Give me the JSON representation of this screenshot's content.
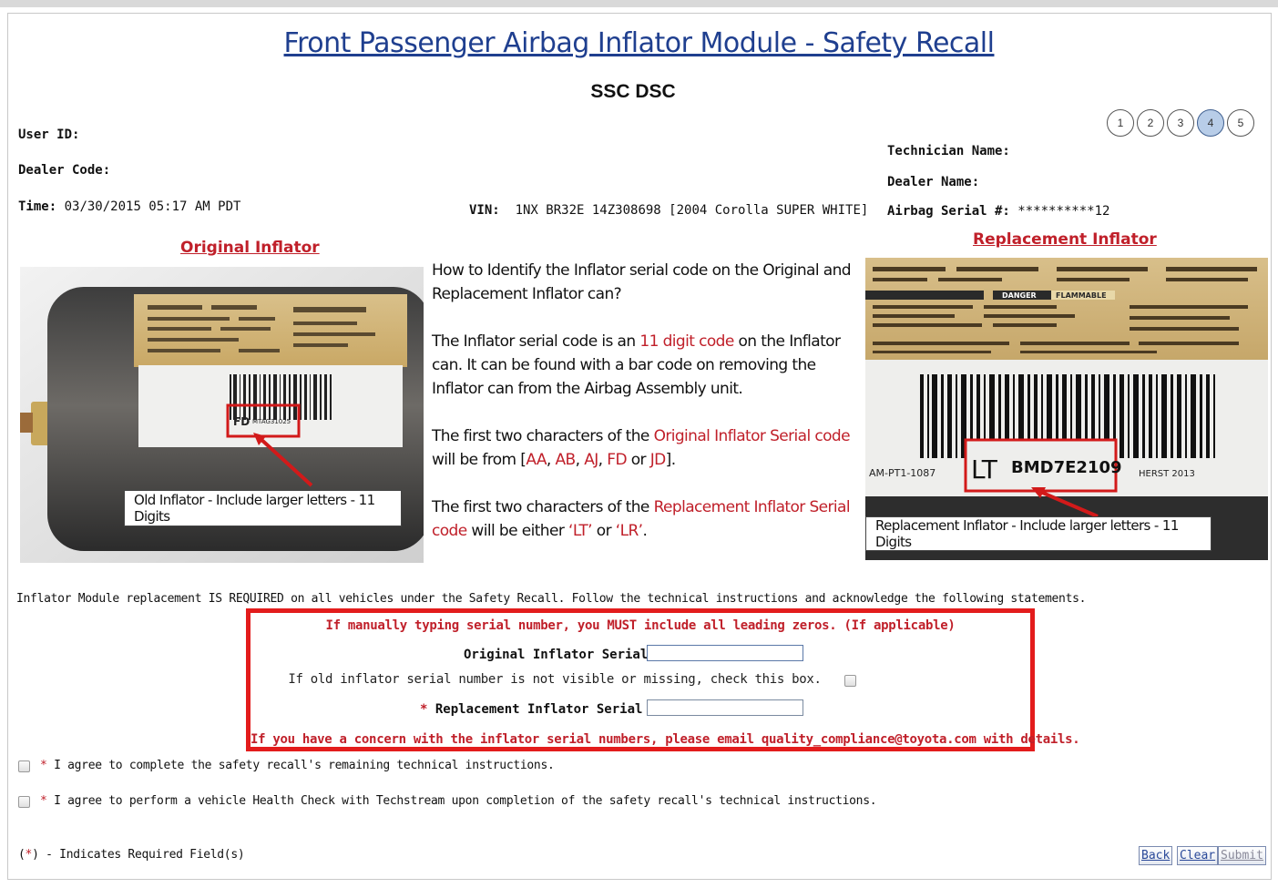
{
  "page": {
    "title": "Front Passenger Airbag Inflator Module - Safety Recall",
    "subtitle": "SSC DSC"
  },
  "steps": [
    {
      "label": "1",
      "active": false
    },
    {
      "label": "2",
      "active": false
    },
    {
      "label": "3",
      "active": false
    },
    {
      "label": "4",
      "active": true
    },
    {
      "label": "5",
      "active": false
    }
  ],
  "info": {
    "user_id_label": "User ID:",
    "dealer_code_label": "Dealer Code:",
    "time_label": "Time:",
    "time_value": "03/30/2015 05:17 AM PDT",
    "vin_label": "VIN:",
    "vin_value": "1NX BR32E 14Z308698 [2004 Corolla SUPER WHITE]",
    "technician_name_label": "Technician Name:",
    "dealer_name_label": "Dealer Name:",
    "airbag_serial_label": "Airbag Serial #:",
    "airbag_serial_value": "**********12"
  },
  "original": {
    "heading": "Original Inflator",
    "caption": "Old Inflator - Include larger letters - 11 Digits",
    "label_prefix": "FD",
    "label_code": "MTAG31025"
  },
  "replacement": {
    "heading": "Replacement Inflator",
    "caption": "Replacement Inflator - Include larger letters - 11 Digits",
    "label_prefix": "LT",
    "label_code": "BMD7E2109",
    "label_left": "AM-PT1-1087",
    "label_right": "HERST 2013",
    "danger_text": "DANGER",
    "flammable_text": "FLAMMABLE"
  },
  "instructions": {
    "question": "How to Identify the Inflator serial code on the Original and Replacement Inflator can?",
    "p1_a": "The Inflator serial code is an ",
    "p1_highlight": "11 digit code",
    "p1_b": " on the Inflator can. It can be found with a bar code on removing the Inflator can from the Airbag Assembly unit.",
    "p2_a": "The first two characters of the ",
    "p2_highlight": "Original Inflator Serial code",
    "p2_b": " will be from [",
    "p2_codes": [
      "AA",
      "AB",
      "AJ",
      "FD",
      "JD"
    ],
    "p2_c": "].",
    "p3_a": "The first two characters of the ",
    "p3_highlight": "Replacement Inflator Serial code",
    "p3_b": " will be either ",
    "p3_code1": "‘LT’",
    "p3_or": " or ",
    "p3_code2": "‘LR’",
    "p3_c": "."
  },
  "form": {
    "required_notice": "Inflator Module replacement IS REQUIRED on all vehicles under the Safety Recall. Follow the technical instructions and acknowledge the following statements.",
    "leading_zero_warning": "If manually typing serial number, you MUST include all leading zeros. (If applicable)",
    "original_serial_label": "Original Inflator Serial #:",
    "original_serial_value": "",
    "missing_check_label": "If old inflator serial number is not visible or missing, check this box.",
    "replacement_serial_label": "Replacement Inflator Serial #:",
    "replacement_serial_value": "",
    "concern_text": "If you have a concern with the inflator serial numbers, please email quality_compliance@toyota.com with details.",
    "agree1": "I agree to complete the safety recall's remaining technical instructions.",
    "agree2": "I agree to perform a vehicle Health Check with Techstream upon completion of the safety recall's technical instructions.",
    "required_legend_a": "(",
    "required_legend_star": "*",
    "required_legend_b": ") - Indicates Required Field(s)"
  },
  "buttons": {
    "back": "Back",
    "clear": "Clear",
    "submit": "Submit"
  },
  "colors": {
    "title_blue": "#1f3f8f",
    "accent_red": "#c0202a",
    "highlight_box_red": "#e31c1c",
    "link_blue": "#3a78b8",
    "active_step": "#b8cde8"
  }
}
